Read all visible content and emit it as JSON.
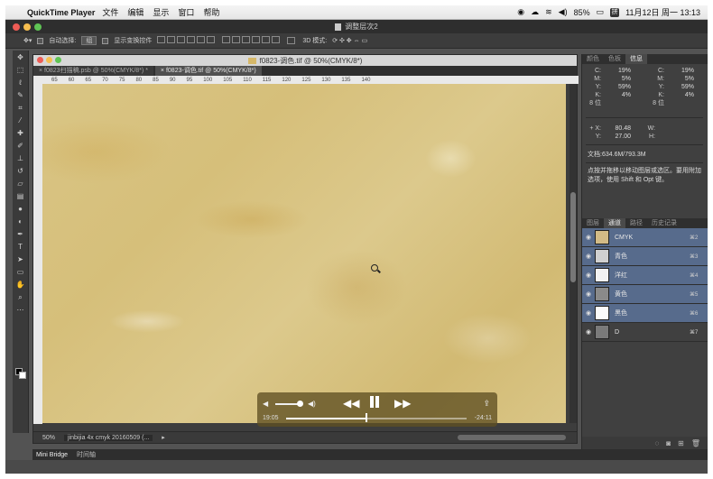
{
  "menubar": {
    "app_name": "QuickTime Player",
    "items": [
      "文件",
      "编辑",
      "显示",
      "窗口",
      "帮助"
    ],
    "battery": "85%",
    "ime": "拼",
    "datetime": "11月12日 周一 13:13"
  },
  "ps": {
    "window_title": "调整层次2",
    "options": {
      "auto_select_label": "自动选择:",
      "auto_select_value": "组",
      "show_transform_label": "显示变换控件",
      "mode_3d_label": "3D 模式:"
    }
  },
  "document": {
    "window_title": "f0823-调色.tif @ 50%(CMYK/8*)",
    "tabs": [
      {
        "label": "f0823扫描稿.psb @ 50%(CMYK/8*) *"
      },
      {
        "label": "f0823-调色.tif @ 50%(CMYK/8*)"
      }
    ],
    "ruler_ticks": [
      "65",
      "60",
      "65",
      "70",
      "75",
      "80",
      "85",
      "90",
      "95",
      "100",
      "105",
      "110",
      "115",
      "120",
      "125",
      "130",
      "135",
      "140"
    ],
    "zoom": "50%",
    "status_info": "jinbijia 4x cmyk 20160509 (..."
  },
  "quicktime": {
    "current_time": "19:05",
    "remaining_time": "-24:11",
    "progress": 0.44,
    "volume": 0.85
  },
  "info_panel": {
    "tabs": [
      "颜色",
      "色板",
      "信息"
    ],
    "left": [
      {
        "k": "C:",
        "v": "19%"
      },
      {
        "k": "M:",
        "v": "5%"
      },
      {
        "k": "Y:",
        "v": "59%"
      },
      {
        "k": "K:",
        "v": "4%"
      },
      {
        "k": "8 位",
        "v": ""
      }
    ],
    "right": [
      {
        "k": "C:",
        "v": "19%"
      },
      {
        "k": "M:",
        "v": "5%"
      },
      {
        "k": "Y:",
        "v": "59%"
      },
      {
        "k": "K:",
        "v": "4%"
      },
      {
        "k": "8 位",
        "v": ""
      }
    ],
    "x": "80.48",
    "y": "27.00",
    "w_label": "W:",
    "h_label": "H:",
    "doc_size": "文档:634.6M/793.3M",
    "hint": "点按并拖移以移动图层或选区。要用附加选项，使用 Shift 和 Opt 键。"
  },
  "channels_panel": {
    "tabs": [
      "图层",
      "通道",
      "路径",
      "历史记录"
    ],
    "channels": [
      {
        "name": "CMYK",
        "key": "⌘2",
        "thumb": "#d2bb86",
        "selected": true
      },
      {
        "name": "青色",
        "key": "⌘3",
        "thumb": "#d0d0d0",
        "selected": true
      },
      {
        "name": "洋红",
        "key": "⌘4",
        "thumb": "#f2f2f2",
        "selected": true
      },
      {
        "name": "黄色",
        "key": "⌘5",
        "thumb": "#8a8a8a",
        "selected": true
      },
      {
        "name": "黑色",
        "key": "⌘6",
        "thumb": "#fafafa",
        "selected": true
      },
      {
        "name": "D",
        "key": "⌘7",
        "thumb": "#7a7a7a",
        "selected": false
      }
    ]
  },
  "bottom": {
    "tabs": [
      "Mini Bridge",
      "时间轴"
    ]
  }
}
